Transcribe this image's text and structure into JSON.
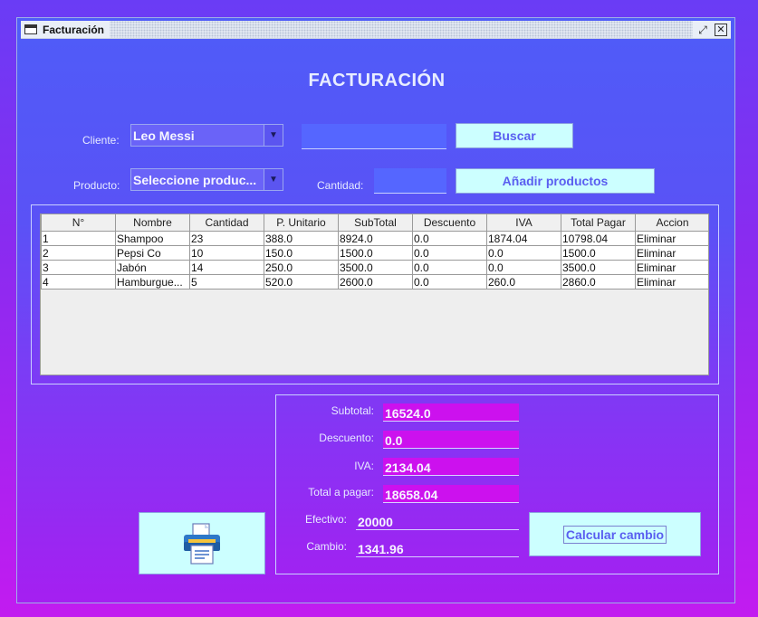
{
  "window": {
    "title": "Facturación"
  },
  "heading": "FACTURACIÓN",
  "form": {
    "cliente_label": "Cliente:",
    "cliente_value": "Leo Messi",
    "producto_label": "Producto:",
    "producto_value": "Seleccione produc...",
    "cantidad_label": "Cantidad:",
    "buscar_label": "Buscar",
    "anadir_label": "Añadir productos"
  },
  "table": {
    "headers": [
      "N°",
      "Nombre",
      "Cantidad",
      "P. Unitario",
      "SubTotal",
      "Descuento",
      "IVA",
      "Total Pagar",
      "Accion"
    ],
    "rows": [
      [
        "1",
        "Shampoo",
        "23",
        "388.0",
        "8924.0",
        "0.0",
        "1874.04",
        "10798.04",
        "Eliminar"
      ],
      [
        "2",
        "Pepsi Co",
        "10",
        "150.0",
        "1500.0",
        "0.0",
        "0.0",
        "1500.0",
        "Eliminar"
      ],
      [
        "3",
        "Jabón",
        "14",
        "250.0",
        "3500.0",
        "0.0",
        "0.0",
        "3500.0",
        "Eliminar"
      ],
      [
        "4",
        "Hamburgue...",
        "5",
        "520.0",
        "2600.0",
        "0.0",
        "260.0",
        "2860.0",
        "Eliminar"
      ]
    ]
  },
  "totals": {
    "subtotal_label": "Subtotal:",
    "subtotal_value": "16524.0",
    "descuento_label": "Descuento:",
    "descuento_value": "0.0",
    "iva_label": "IVA:",
    "iva_value": "2134.04",
    "total_label": "Total a pagar:",
    "total_value": "18658.04",
    "efectivo_label": "Efectivo:",
    "efectivo_value": "20000",
    "cambio_label": "Cambio:",
    "cambio_value": "1341.96",
    "calcular_label": "Calcular cambio"
  },
  "icons": {
    "print": "printer-icon"
  }
}
